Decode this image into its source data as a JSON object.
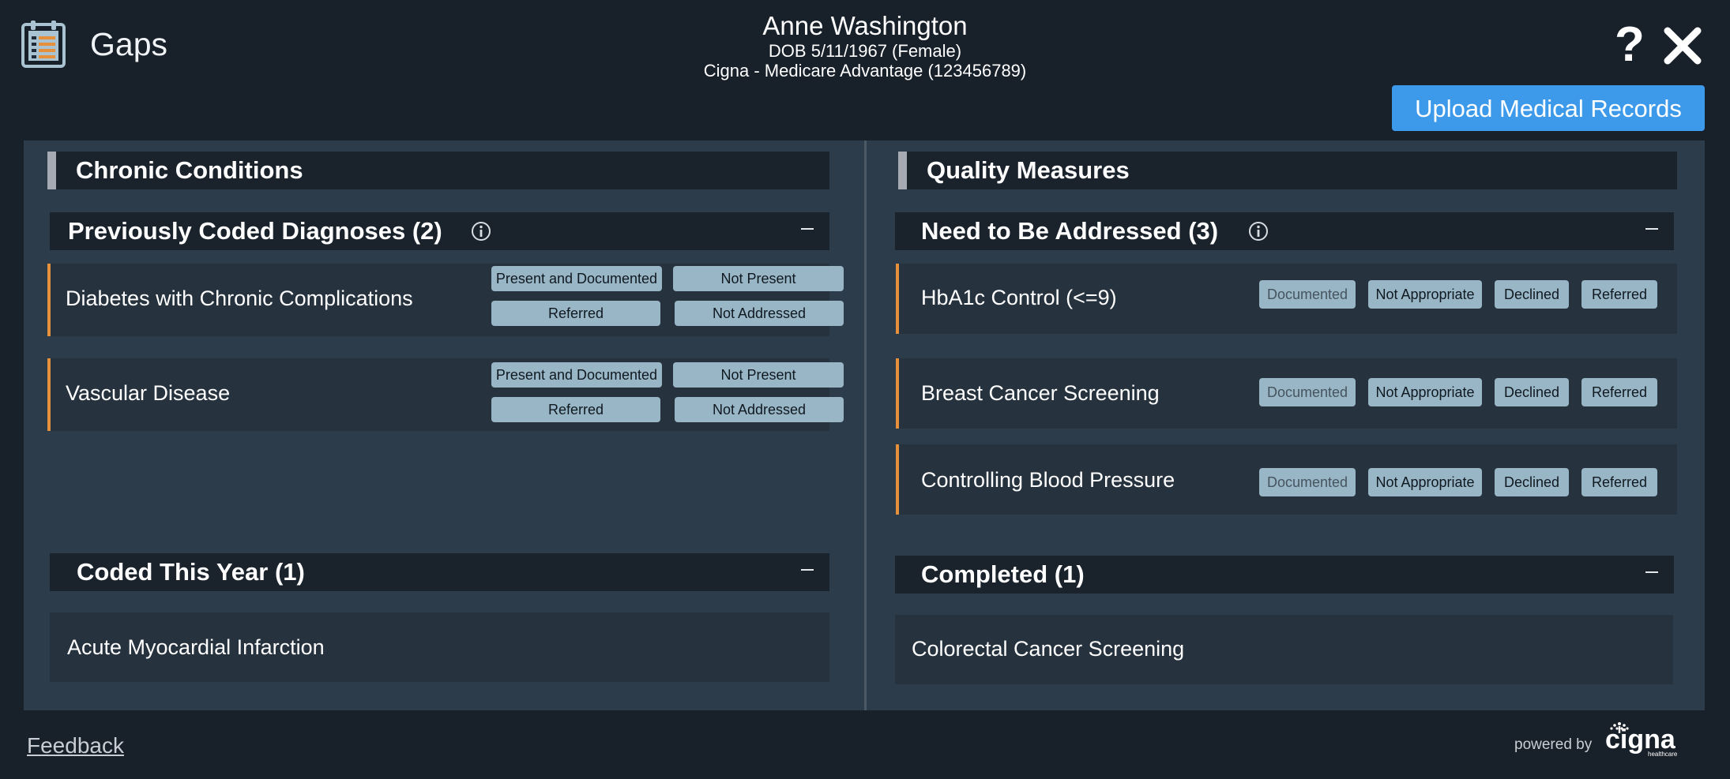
{
  "app": {
    "title": "Gaps",
    "logo_icon": "clipboard-list-icon"
  },
  "patient": {
    "name": "Anne Washington",
    "dob_line": "DOB 5/11/1967 (Female)",
    "plan_line": "Cigna - Medicare Advantage (123456789)"
  },
  "header": {
    "help_label": "?",
    "close_icon": "close-icon",
    "upload_label": "Upload Medical Records"
  },
  "chronic": {
    "title": "Chronic Conditions",
    "previously_coded": {
      "title": "Previously Coded Diagnoses (2)",
      "items": [
        {
          "label": "Diabetes with Chronic Complications",
          "actions": [
            "Present and Documented",
            "Not Present",
            "Referred",
            "Not Addressed"
          ]
        },
        {
          "label": "Vascular Disease",
          "actions": [
            "Present and Documented",
            "Not Present",
            "Referred",
            "Not Addressed"
          ]
        }
      ]
    },
    "coded_this_year": {
      "title": "Coded This Year (1)",
      "items": [
        {
          "label": "Acute Myocardial Infarction"
        }
      ]
    }
  },
  "quality": {
    "title": "Quality Measures",
    "need_addressed": {
      "title": "Need to Be Addressed (3)",
      "items": [
        {
          "label": "HbA1c Control (<=9)",
          "actions": [
            "Documented",
            "Not Appropriate",
            "Declined",
            "Referred"
          ]
        },
        {
          "label": "Breast Cancer Screening",
          "actions": [
            "Documented",
            "Not Appropriate",
            "Declined",
            "Referred"
          ]
        },
        {
          "label": "Controlling Blood Pressure",
          "actions": [
            "Documented",
            "Not Appropriate",
            "Declined",
            "Referred"
          ]
        }
      ]
    },
    "completed": {
      "title": "Completed (1)",
      "items": [
        {
          "label": "Colorectal Cancer Screening"
        }
      ]
    }
  },
  "footer": {
    "feedback_label": "Feedback",
    "powered_by": "powered by",
    "brand_logo_text": "cigna",
    "brand_logo_sub": "healthcare"
  },
  "colors": {
    "accent_orange": "#e7903c",
    "upload_blue": "#3d99ea",
    "chip": "#98b6c5",
    "panel": "#2d3c4a",
    "background": "#18202a"
  }
}
